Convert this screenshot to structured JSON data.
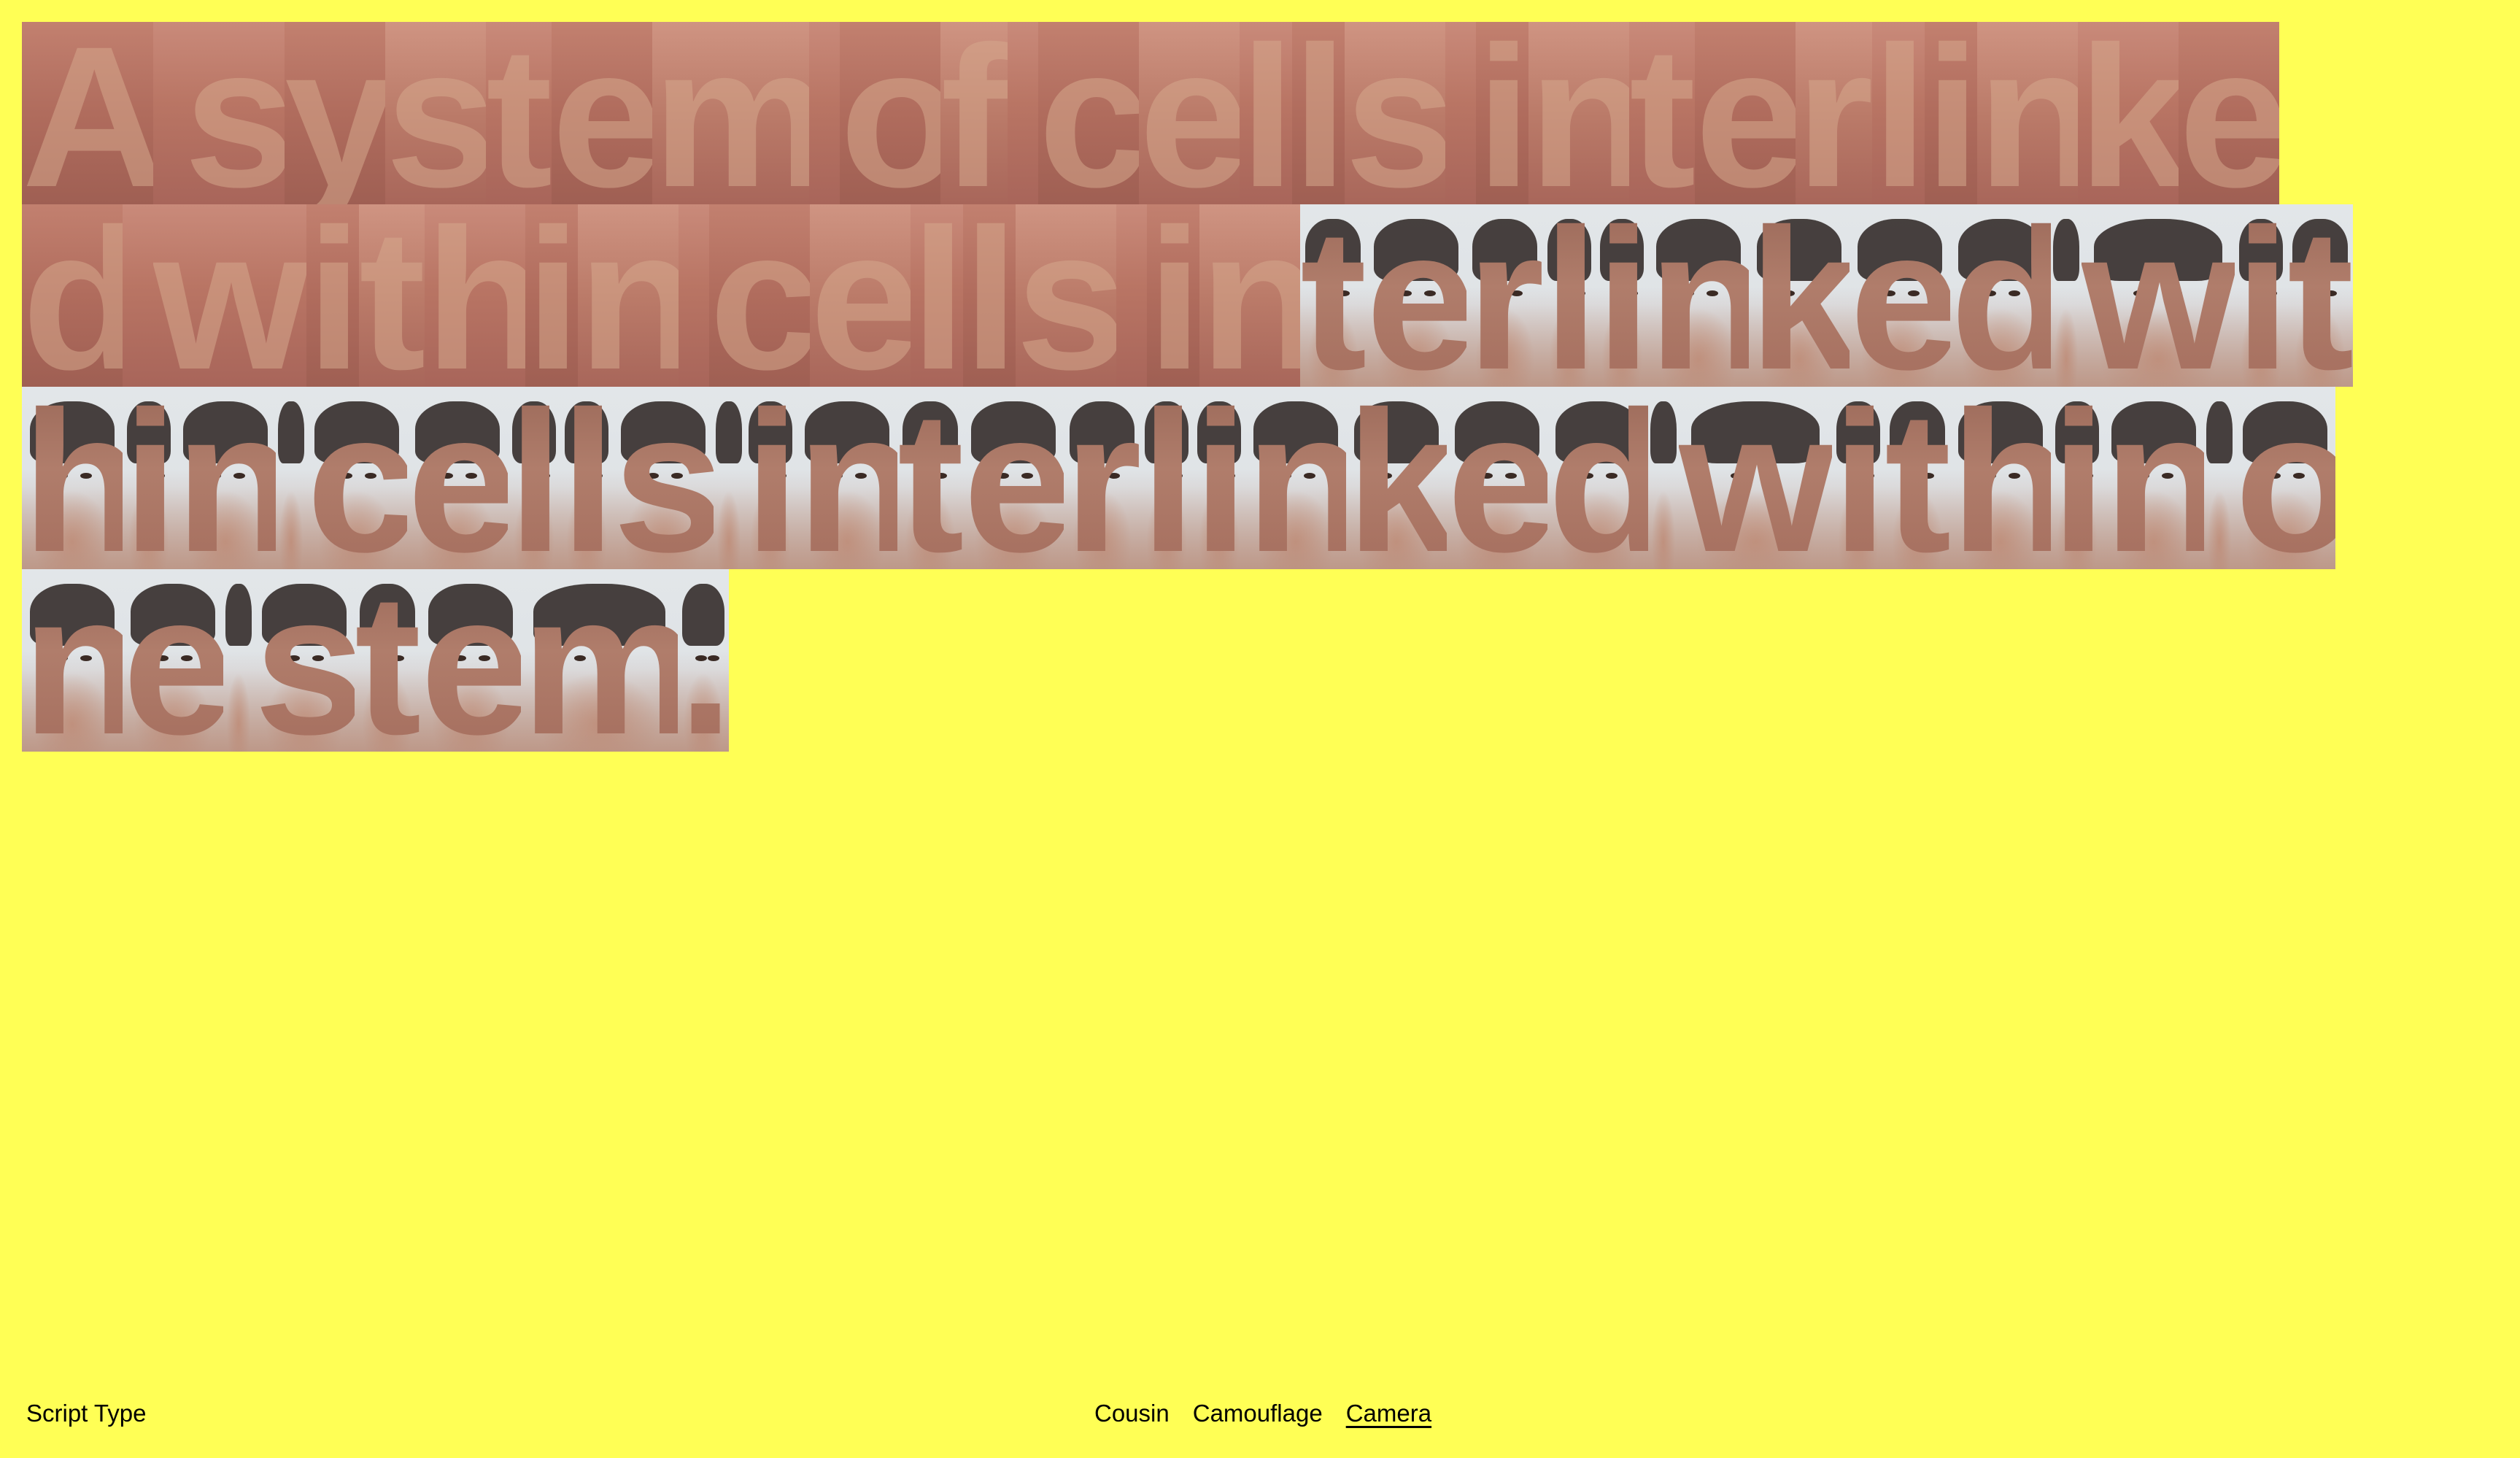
{
  "theme": {
    "background": "#ffff55",
    "text": "#000000"
  },
  "camera_text": {
    "rows": [
      "A system of cells interlinke",
      "d within cells interlinked wit",
      "hin cells interlinked within o",
      "ne stem."
    ],
    "photo_start": [
      null,
      17,
      0,
      0
    ]
  },
  "footer": {
    "brand": "Script Type",
    "menu": [
      {
        "label": "Cousin",
        "active": false
      },
      {
        "label": "Camouflage",
        "active": false
      },
      {
        "label": "Camera",
        "active": true
      }
    ]
  }
}
